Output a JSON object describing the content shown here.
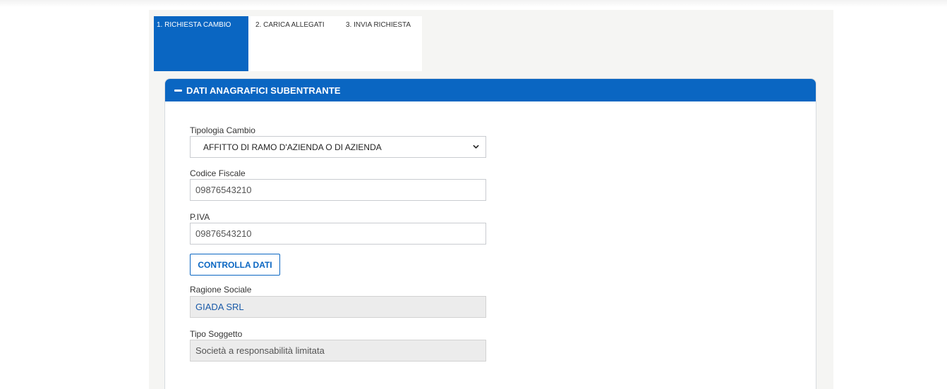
{
  "tabs": [
    {
      "label": "1. RICHIESTA CAMBIO",
      "active": true
    },
    {
      "label": "2. CARICA ALLEGATI",
      "active": false
    },
    {
      "label": "3. INVIA RICHIESTA",
      "active": false
    }
  ],
  "section": {
    "title": "DATI ANAGRAFICI SUBENTRANTE",
    "icon": "minus-icon"
  },
  "form": {
    "tipologia": {
      "label": "Tipologia Cambio",
      "value": "AFFITTO DI RAMO D'AZIENDA O DI AZIENDA"
    },
    "codice_fiscale": {
      "label": "Codice Fiscale",
      "value": "09876543210"
    },
    "piva": {
      "label": "P.IVA",
      "value": "09876543210"
    },
    "check_button": "CONTROLLA DATI",
    "ragione_sociale": {
      "label": "Ragione Sociale",
      "value": "GIADA SRL"
    },
    "tipo_soggetto": {
      "label": "Tipo Soggetto",
      "value": "Società a responsabilità limitata"
    }
  },
  "colors": {
    "primary": "#0a66c2",
    "readonly_bg": "#ececec",
    "page_bg": "#f5f5f3"
  }
}
